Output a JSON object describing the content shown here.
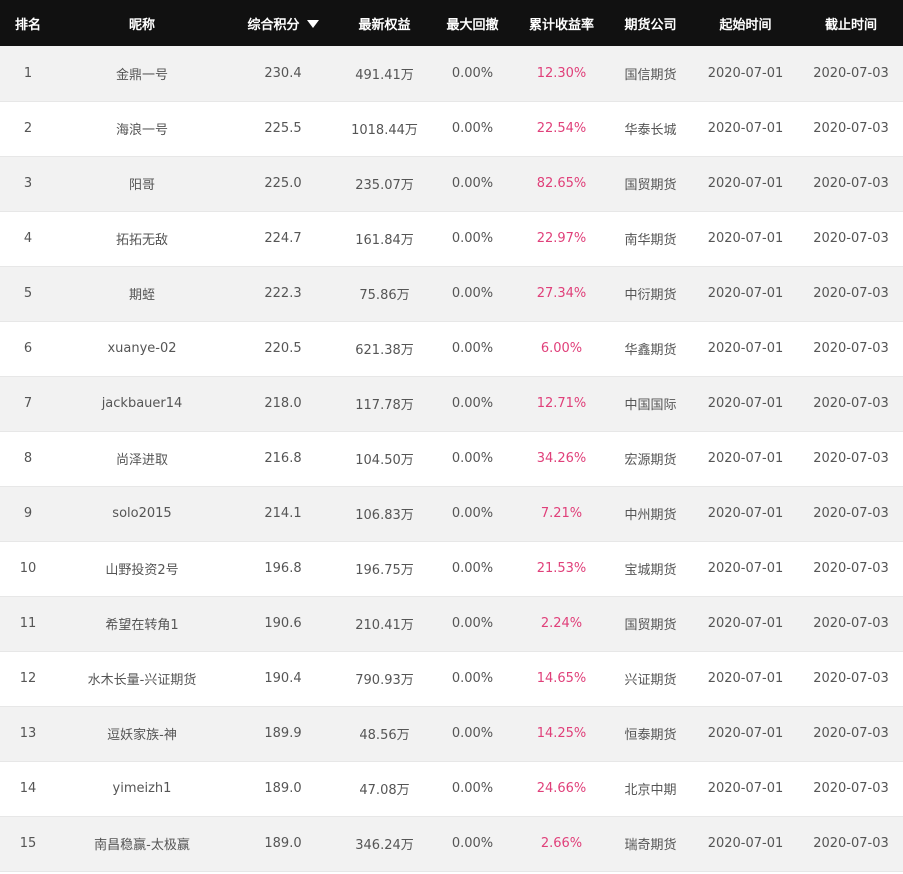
{
  "header": {
    "rank": "排名",
    "nickname": "昵称",
    "score": "综合积分",
    "equity": "最新权益",
    "drawdown": "最大回撤",
    "return": "累计收益率",
    "company": "期货公司",
    "start": "起始时间",
    "end": "截止时间"
  },
  "sort": {
    "column": "综合积分",
    "direction": "descending",
    "icon": "sort-down-icon"
  },
  "colors": {
    "header_bg": "#111111",
    "return_text": "#e0407a",
    "row_alt": "#f2f2f2"
  },
  "rows": [
    {
      "rank": "1",
      "nickname": "金鼎一号",
      "score": "230.4",
      "equity": "491.41万",
      "drawdown": "0.00%",
      "return": "12.30%",
      "company": "国信期货",
      "start": "2020-07-01",
      "end": "2020-07-03"
    },
    {
      "rank": "2",
      "nickname": "海浪一号",
      "score": "225.5",
      "equity": "1018.44万",
      "drawdown": "0.00%",
      "return": "22.54%",
      "company": "华泰长城",
      "start": "2020-07-01",
      "end": "2020-07-03"
    },
    {
      "rank": "3",
      "nickname": "阳哥",
      "score": "225.0",
      "equity": "235.07万",
      "drawdown": "0.00%",
      "return": "82.65%",
      "company": "国贸期货",
      "start": "2020-07-01",
      "end": "2020-07-03"
    },
    {
      "rank": "4",
      "nickname": "拓拓无敌",
      "score": "224.7",
      "equity": "161.84万",
      "drawdown": "0.00%",
      "return": "22.97%",
      "company": "南华期货",
      "start": "2020-07-01",
      "end": "2020-07-03"
    },
    {
      "rank": "5",
      "nickname": "期蛭",
      "score": "222.3",
      "equity": "75.86万",
      "drawdown": "0.00%",
      "return": "27.34%",
      "company": "中衍期货",
      "start": "2020-07-01",
      "end": "2020-07-03"
    },
    {
      "rank": "6",
      "nickname": "xuanye-02",
      "score": "220.5",
      "equity": "621.38万",
      "drawdown": "0.00%",
      "return": "6.00%",
      "company": "华鑫期货",
      "start": "2020-07-01",
      "end": "2020-07-03"
    },
    {
      "rank": "7",
      "nickname": "jackbauer14",
      "score": "218.0",
      "equity": "117.78万",
      "drawdown": "0.00%",
      "return": "12.71%",
      "company": "中国国际",
      "start": "2020-07-01",
      "end": "2020-07-03"
    },
    {
      "rank": "8",
      "nickname": "尚泽进取",
      "score": "216.8",
      "equity": "104.50万",
      "drawdown": "0.00%",
      "return": "34.26%",
      "company": "宏源期货",
      "start": "2020-07-01",
      "end": "2020-07-03"
    },
    {
      "rank": "9",
      "nickname": "solo2015",
      "score": "214.1",
      "equity": "106.83万",
      "drawdown": "0.00%",
      "return": "7.21%",
      "company": "中州期货",
      "start": "2020-07-01",
      "end": "2020-07-03"
    },
    {
      "rank": "10",
      "nickname": "山野投资2号",
      "score": "196.8",
      "equity": "196.75万",
      "drawdown": "0.00%",
      "return": "21.53%",
      "company": "宝城期货",
      "start": "2020-07-01",
      "end": "2020-07-03"
    },
    {
      "rank": "11",
      "nickname": "希望在转角1",
      "score": "190.6",
      "equity": "210.41万",
      "drawdown": "0.00%",
      "return": "2.24%",
      "company": "国贸期货",
      "start": "2020-07-01",
      "end": "2020-07-03"
    },
    {
      "rank": "12",
      "nickname": "水木长量-兴证期货",
      "score": "190.4",
      "equity": "790.93万",
      "drawdown": "0.00%",
      "return": "14.65%",
      "company": "兴证期货",
      "start": "2020-07-01",
      "end": "2020-07-03"
    },
    {
      "rank": "13",
      "nickname": "逗妖家族-神",
      "score": "189.9",
      "equity": "48.56万",
      "drawdown": "0.00%",
      "return": "14.25%",
      "company": "恒泰期货",
      "start": "2020-07-01",
      "end": "2020-07-03"
    },
    {
      "rank": "14",
      "nickname": "yimeizh1",
      "score": "189.0",
      "equity": "47.08万",
      "drawdown": "0.00%",
      "return": "24.66%",
      "company": "北京中期",
      "start": "2020-07-01",
      "end": "2020-07-03"
    },
    {
      "rank": "15",
      "nickname": "南昌稳赢-太极赢",
      "score": "189.0",
      "equity": "346.24万",
      "drawdown": "0.00%",
      "return": "2.66%",
      "company": "瑞奇期货",
      "start": "2020-07-01",
      "end": "2020-07-03"
    }
  ]
}
